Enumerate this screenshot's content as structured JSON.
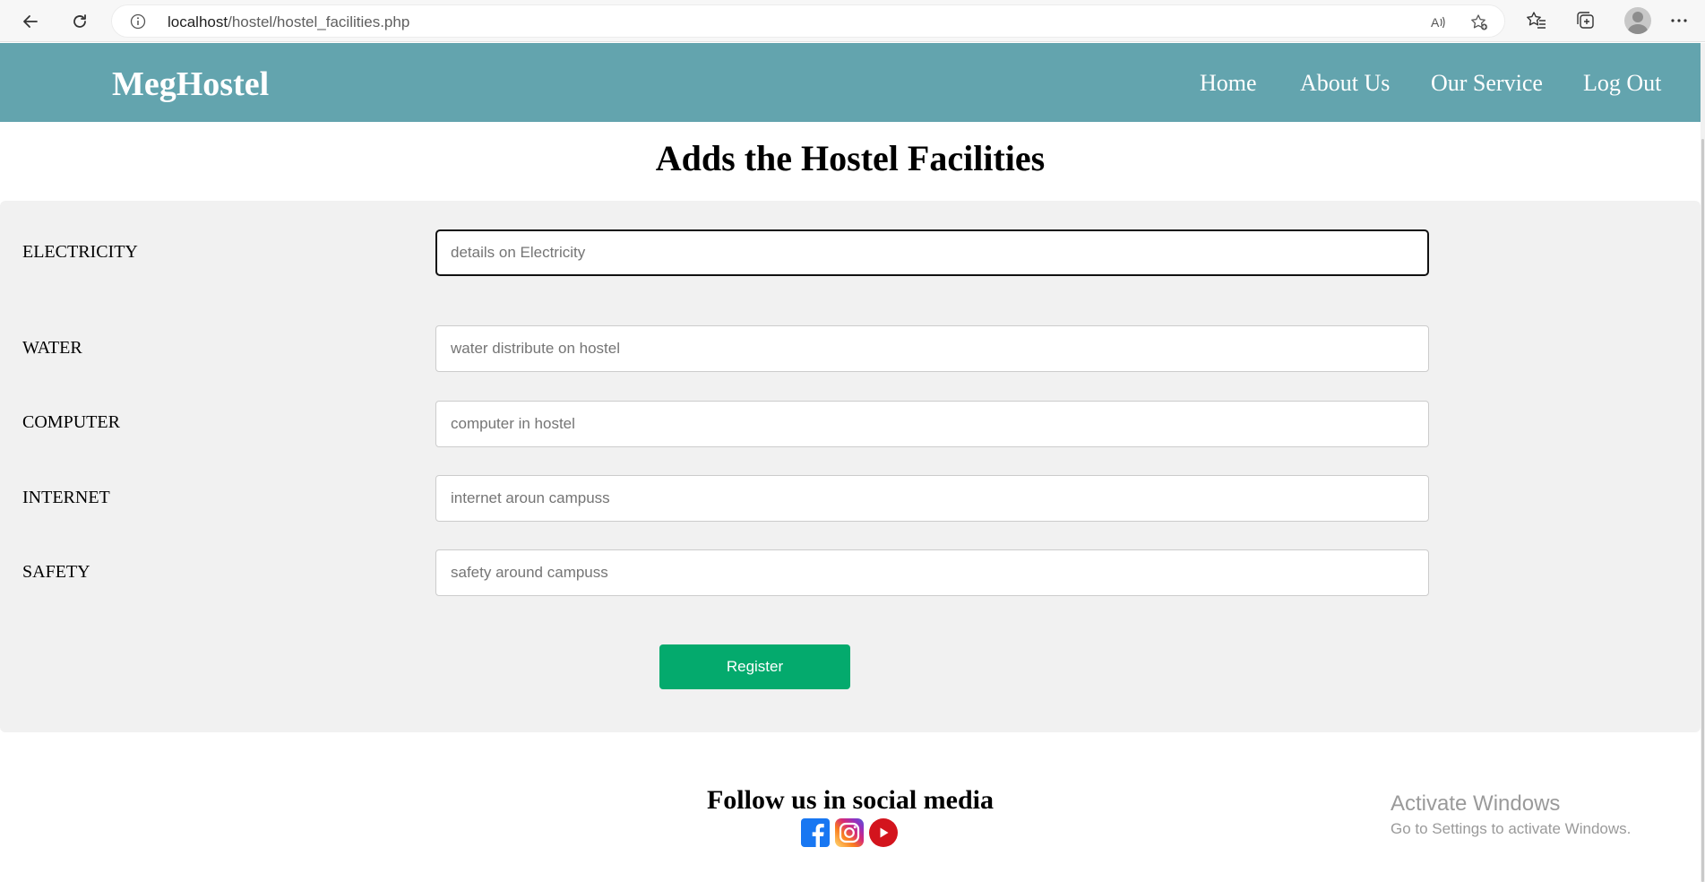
{
  "browser": {
    "url_host": "localhost",
    "url_path": "/hostel/hostel_facilities.php"
  },
  "header": {
    "brand": "MegHostel",
    "nav": [
      {
        "label": "Home"
      },
      {
        "label": "About Us"
      },
      {
        "label": "Our Service"
      },
      {
        "label": "Log Out"
      }
    ],
    "bg_color": "#63a4ae"
  },
  "page": {
    "title": "Adds the Hostel Facilities"
  },
  "form": {
    "fields": [
      {
        "label": "ELECTRICITY",
        "placeholder": "details on Electricity",
        "value": ""
      },
      {
        "label": "WATER",
        "placeholder": "water distribute on hostel",
        "value": ""
      },
      {
        "label": "COMPUTER",
        "placeholder": "computer in hostel",
        "value": ""
      },
      {
        "label": "INTERNET",
        "placeholder": "internet aroun campuss",
        "value": ""
      },
      {
        "label": "SAFETY",
        "placeholder": "safety around campuss",
        "value": ""
      }
    ],
    "submit_label": "Register",
    "submit_color": "#04aa6d"
  },
  "footer": {
    "follow_title": "Follow us in social media",
    "social_icons": [
      "facebook-icon",
      "instagram-icon",
      "youtube-icon"
    ]
  },
  "watermark": {
    "title": "Activate Windows",
    "subtitle": "Go to Settings to activate Windows."
  }
}
